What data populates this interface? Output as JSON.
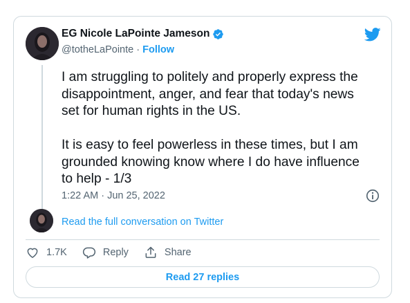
{
  "tweet": {
    "author": {
      "display_name": "EG Nicole LaPointe Jameson",
      "handle": "@totheLaPointe",
      "separator": " · ",
      "follow_label": "Follow"
    },
    "text": {
      "paragraph_1": "I am struggling to politely and properly express the\ndisappointment, anger, and fear that today's news\nset for human rights in the US.",
      "paragraph_2": "It is easy to feel powerless in these times, but I am\ngrounded knowing know where I do have influence\nto help - 1/3"
    },
    "timestamp": "1:22 AM · Jun 25, 2022",
    "read_full_label": "Read the full conversation on Twitter",
    "actions": {
      "like_count": "1.7K",
      "reply_label": "Reply",
      "share_label": "Share"
    },
    "read_replies_label": "Read 27 replies"
  },
  "icons": {
    "brand": "twitter-bird-icon",
    "verified": "verified-badge-icon",
    "info": "info-icon",
    "like": "heart-icon",
    "reply": "reply-bubble-icon",
    "share": "share-icon"
  },
  "colors": {
    "accent": "#1d9bf0",
    "text": "#0f1419",
    "secondary_text": "#536471",
    "border": "#cfd9de"
  }
}
